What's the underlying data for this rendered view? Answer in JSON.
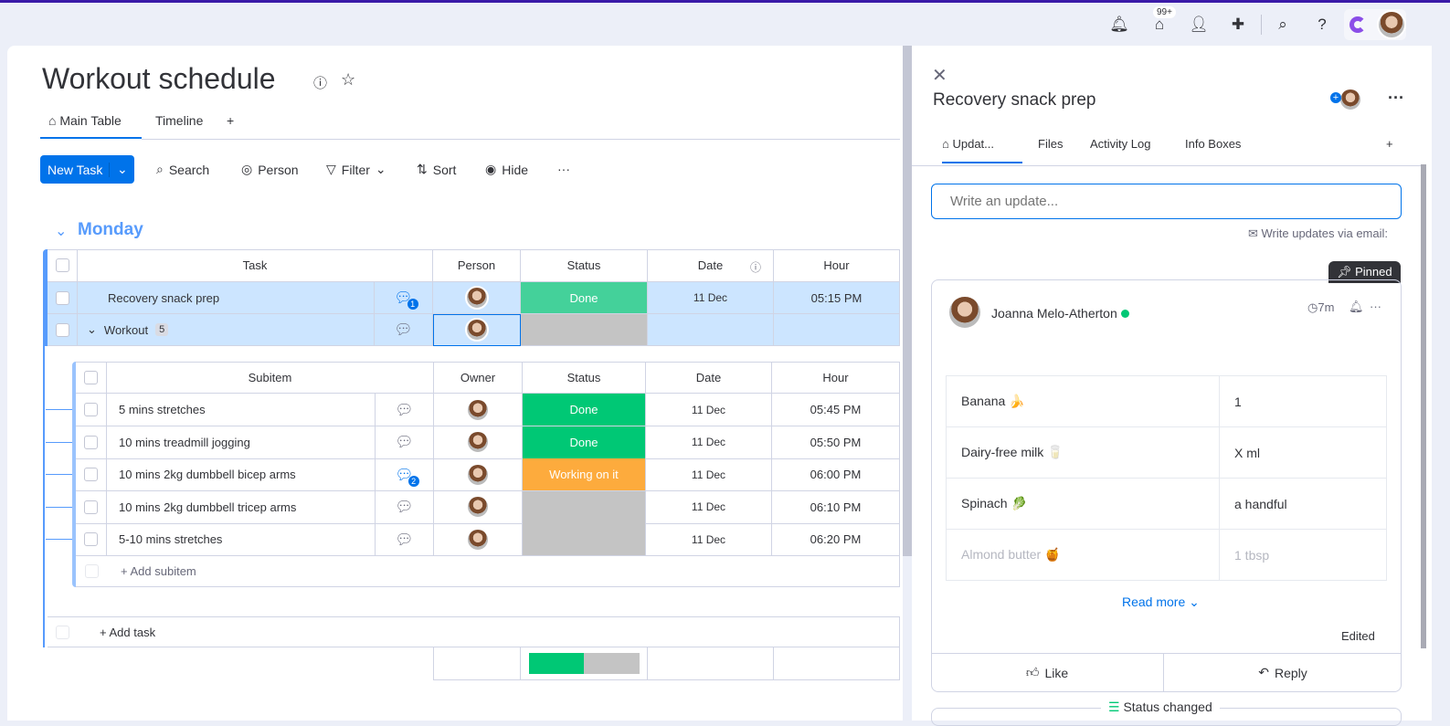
{
  "topbar": {
    "inbox_badge": "99+",
    "icons": [
      "bell-icon",
      "inbox-icon",
      "invite-icon",
      "apps-icon",
      "search-icon",
      "help-icon"
    ]
  },
  "board": {
    "title": "Workout schedule",
    "tabs": [
      "Main Table",
      "Timeline",
      "+"
    ],
    "toolbar": {
      "new_task": "New Task",
      "search": "Search",
      "person": "Person",
      "filter": "Filter",
      "sort": "Sort",
      "hide": "Hide"
    },
    "group": "Monday",
    "columns": [
      "Task",
      "Person",
      "Status",
      "Date",
      "Hour"
    ],
    "items": [
      {
        "name": "Recovery snack prep",
        "updates": "1",
        "status": "Done",
        "date": "11 Dec",
        "hour": "05:15 PM"
      },
      {
        "name": "Workout",
        "subcount": "5",
        "status": "",
        "date": "",
        "hour": ""
      }
    ],
    "sub_columns": [
      "Subitem",
      "Owner",
      "Status",
      "Date",
      "Hour"
    ],
    "subitems": [
      {
        "name": "5 mins stretches",
        "updates": "",
        "status": "Done",
        "date": "11 Dec",
        "hour": "05:45 PM"
      },
      {
        "name": "10 mins treadmill jogging",
        "updates": "",
        "status": "Done",
        "date": "11 Dec",
        "hour": "05:50 PM"
      },
      {
        "name": "10 mins 2kg dumbbell bicep arms",
        "updates": "2",
        "status": "Working on it",
        "date": "11 Dec",
        "hour": "06:00 PM"
      },
      {
        "name": "10 mins 2kg dumbbell tricep arms",
        "updates": "",
        "status": "",
        "date": "11 Dec",
        "hour": "06:10 PM"
      },
      {
        "name": "5-10 mins stretches",
        "updates": "",
        "status": "",
        "date": "11 Dec",
        "hour": "06:20 PM"
      }
    ],
    "add_subitem": "+ Add subitem",
    "add_task": "+ Add task",
    "status_summary": {
      "done_fraction": 0.5
    },
    "colors": {
      "done": "#00c875",
      "working": "#fdab3d",
      "empty": "#c4c4c4",
      "accent": "#0073ea",
      "group": "#579bfc"
    }
  },
  "drawer": {
    "title": "Recovery snack prep",
    "tabs": [
      "Updat...",
      "Files",
      "Activity Log",
      "Info Boxes",
      "+"
    ],
    "update_placeholder": "Write an update...",
    "email_link": "Write updates via email:",
    "pinned": "Pinned",
    "post": {
      "author": "Joanna Melo-Atherton",
      "time": "7m",
      "table": [
        [
          "Banana 🍌",
          "1"
        ],
        [
          "Dairy-free milk 🥛",
          "X ml"
        ],
        [
          "Spinach 🥬",
          "a handful"
        ],
        [
          "Almond butter 🍯",
          "1 tbsp"
        ]
      ],
      "read_more": "Read more",
      "edited": "Edited",
      "like": "Like",
      "reply": "Reply"
    },
    "next_activity": "Status changed"
  }
}
